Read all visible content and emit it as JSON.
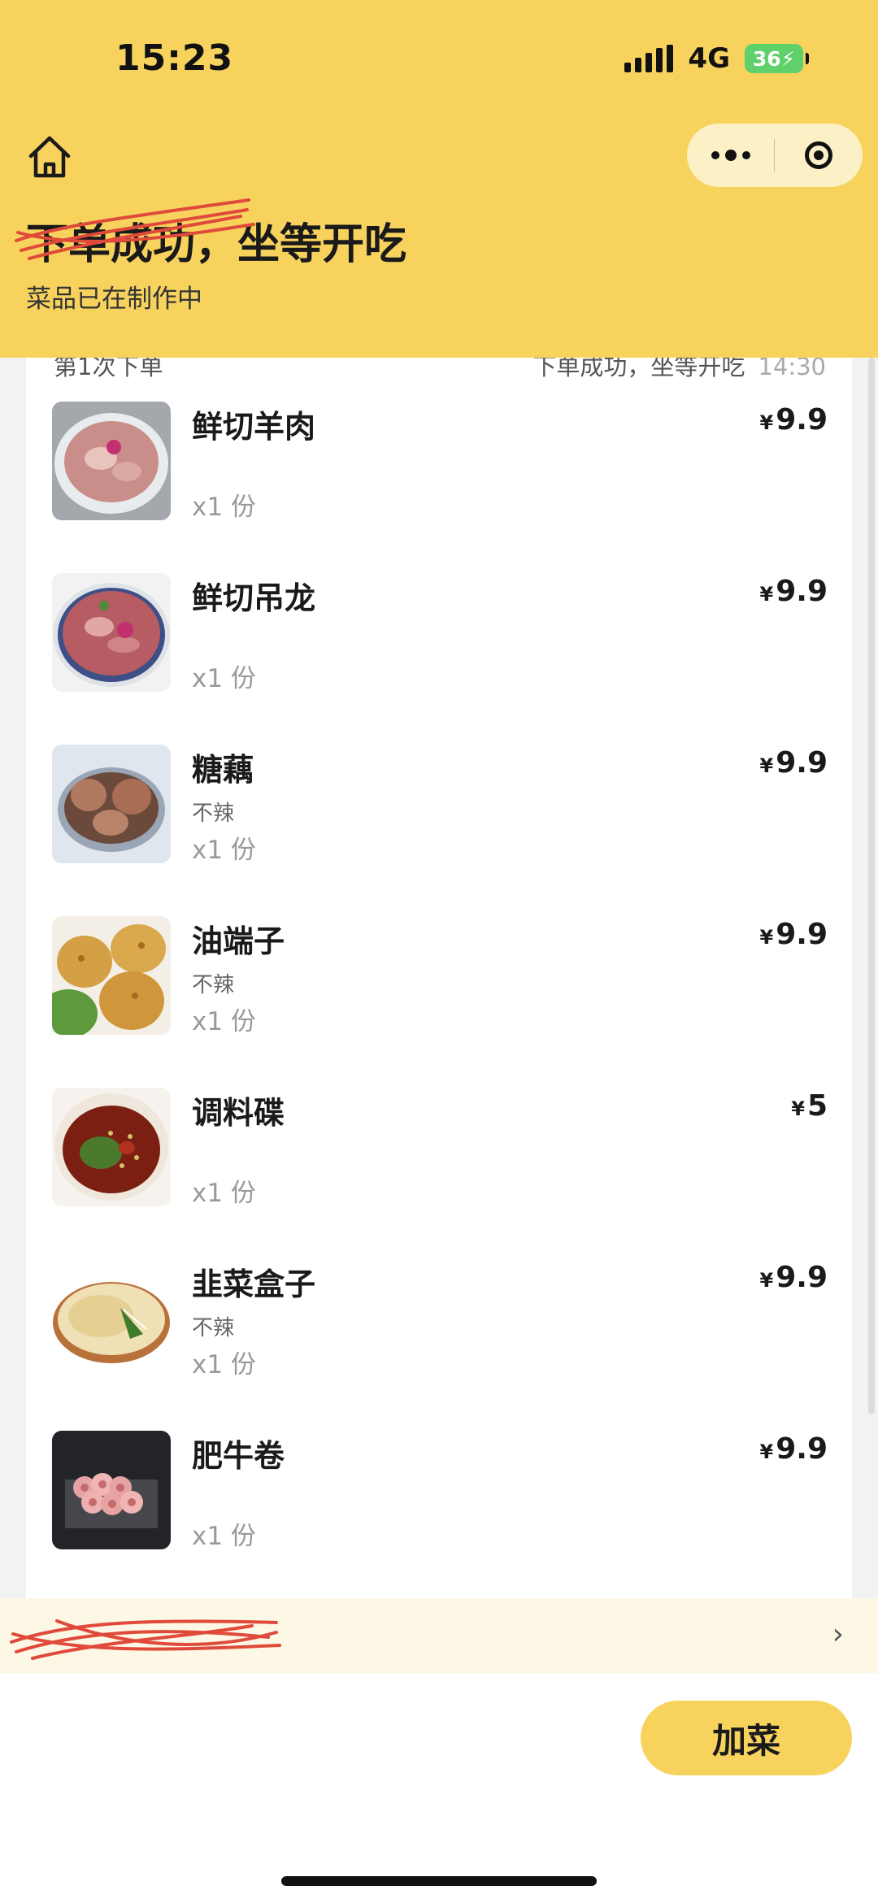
{
  "status_bar": {
    "time": "15:23",
    "network": "4G",
    "battery": "36"
  },
  "header": {
    "title_struck": "下单成功，",
    "title_rest": "坐等开吃",
    "subtitle": "菜品已在制作中"
  },
  "order": {
    "label": "第1次下单",
    "status": "下单成功，坐等开吃",
    "time": "14:30"
  },
  "currency": "¥",
  "items": [
    {
      "name": "鲜切羊肉",
      "option": "",
      "qty": "x1 份",
      "price": "9.9"
    },
    {
      "name": "鲜切吊龙",
      "option": "",
      "qty": "x1 份",
      "price": "9.9"
    },
    {
      "name": "糖藕",
      "option": "不辣",
      "qty": "x1 份",
      "price": "9.9"
    },
    {
      "name": "油端子",
      "option": "不辣",
      "qty": "x1 份",
      "price": "9.9"
    },
    {
      "name": "调料碟",
      "option": "",
      "qty": "x1 份",
      "price": "5"
    },
    {
      "name": "韭菜盒子",
      "option": "不辣",
      "qty": "x1 份",
      "price": "9.9"
    },
    {
      "name": "肥牛卷",
      "option": "",
      "qty": "x1 份",
      "price": "9.9"
    }
  ],
  "notice": {
    "arrow": "›"
  },
  "actions": {
    "add_label": "加菜"
  },
  "colors": {
    "accent": "#f7d35e",
    "capsule": "#fbf0c6",
    "notice_bg": "#fdf7e6"
  },
  "icons": [
    "home-icon",
    "more-dots-icon",
    "target-icon",
    "chevron-right-icon"
  ]
}
